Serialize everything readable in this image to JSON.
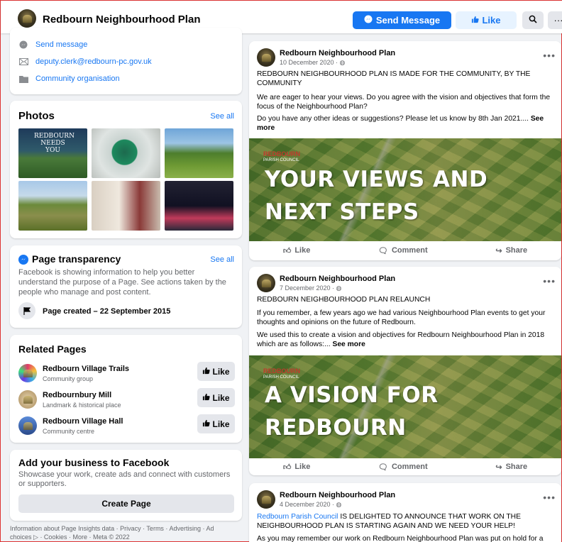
{
  "topbar": {
    "page_name": "Redbourn Neighbourhood Plan",
    "send_message": "Send Message",
    "like": "Like",
    "search_icon": "search-icon",
    "more_label": "···"
  },
  "intro": {
    "send_message": "Send message",
    "email": "deputy.clerk@redbourn-pc.gov.uk",
    "category": "Community organisation"
  },
  "photos": {
    "title": "Photos",
    "see_all": "See all",
    "photo1_text": "REDBOURN NEEDS YOU"
  },
  "transparency": {
    "title": "Page transparency",
    "see_all": "See all",
    "description": "Facebook is showing information to help you better understand the purpose of a Page. See actions taken by the people who manage and post content.",
    "created": "Page created – 22 September 2015"
  },
  "related": {
    "title": "Related Pages",
    "like_label": "Like",
    "pages": [
      {
        "name": "Redbourn Village Trails",
        "sub": "Community group"
      },
      {
        "name": "Redbournbury Mill",
        "sub": "Landmark & historical place"
      },
      {
        "name": "Redbourn Village Hall",
        "sub": "Community centre"
      }
    ]
  },
  "business": {
    "title": "Add your business to Facebook",
    "description": "Showcase your work, create ads and connect with customers or supporters.",
    "button": "Create Page"
  },
  "footer": "Information about Page Insights data · Privacy · Terms · Advertising · Ad choices ▷ · Cookies · More · Meta © 2022",
  "post_actions": {
    "like": "Like",
    "comment": "Comment",
    "share": "Share"
  },
  "posts": [
    {
      "author": "Redbourn Neighbourhood Plan",
      "date": "10 December 2020 · ",
      "p1": "REDBOURN NEIGHBOURHOOD PLAN IS MADE FOR THE COMMUNITY, BY THE COMMUNITY",
      "p2": "We are eager to hear your views. Do you agree with the vision and objectives that form the focus of the Neighbourhood Plan?",
      "p3": "Do you have any other ideas or suggestions? Please let us know by 8th Jan 2021.... ",
      "see_more": "See more",
      "banner_council": "REDBOURN",
      "banner_council_sub": "PARISH COUNCIL",
      "banner_line1": "YOUR VIEWS AND",
      "banner_line2": "NEXT STEPS"
    },
    {
      "author": "Redbourn Neighbourhood Plan",
      "date": "7 December 2020 · ",
      "p1": "REDBOURN NEIGHBOURHOOD PLAN RELAUNCH",
      "p2": "If you remember, a few years ago we had various Neighbourhood Plan events to get your thoughts and opinions on the future of Redbourn.",
      "p3": "We used this to create a vision and objectives for Redbourn Neighbourhood Plan in 2018 which are as follows:... ",
      "see_more": "See more",
      "banner_council": "REDBOURN",
      "banner_council_sub": "PARISH COUNCIL",
      "banner_line1": "A VISION FOR",
      "banner_line2": "REDBOURN"
    },
    {
      "author": "Redbourn Neighbourhood Plan",
      "date": "4 December 2020 · ",
      "mention": "Redbourn Parish Council",
      "p1": " IS DELIGHTED TO ANNOUNCE THAT WORK ON THE NEIGHBOURHOOD PLAN IS STARTING AGAIN AND WE NEED YOUR HELP!",
      "p2": "As you may remember our work on Redbourn Neighbourhood Plan was put on hold for a"
    }
  ]
}
